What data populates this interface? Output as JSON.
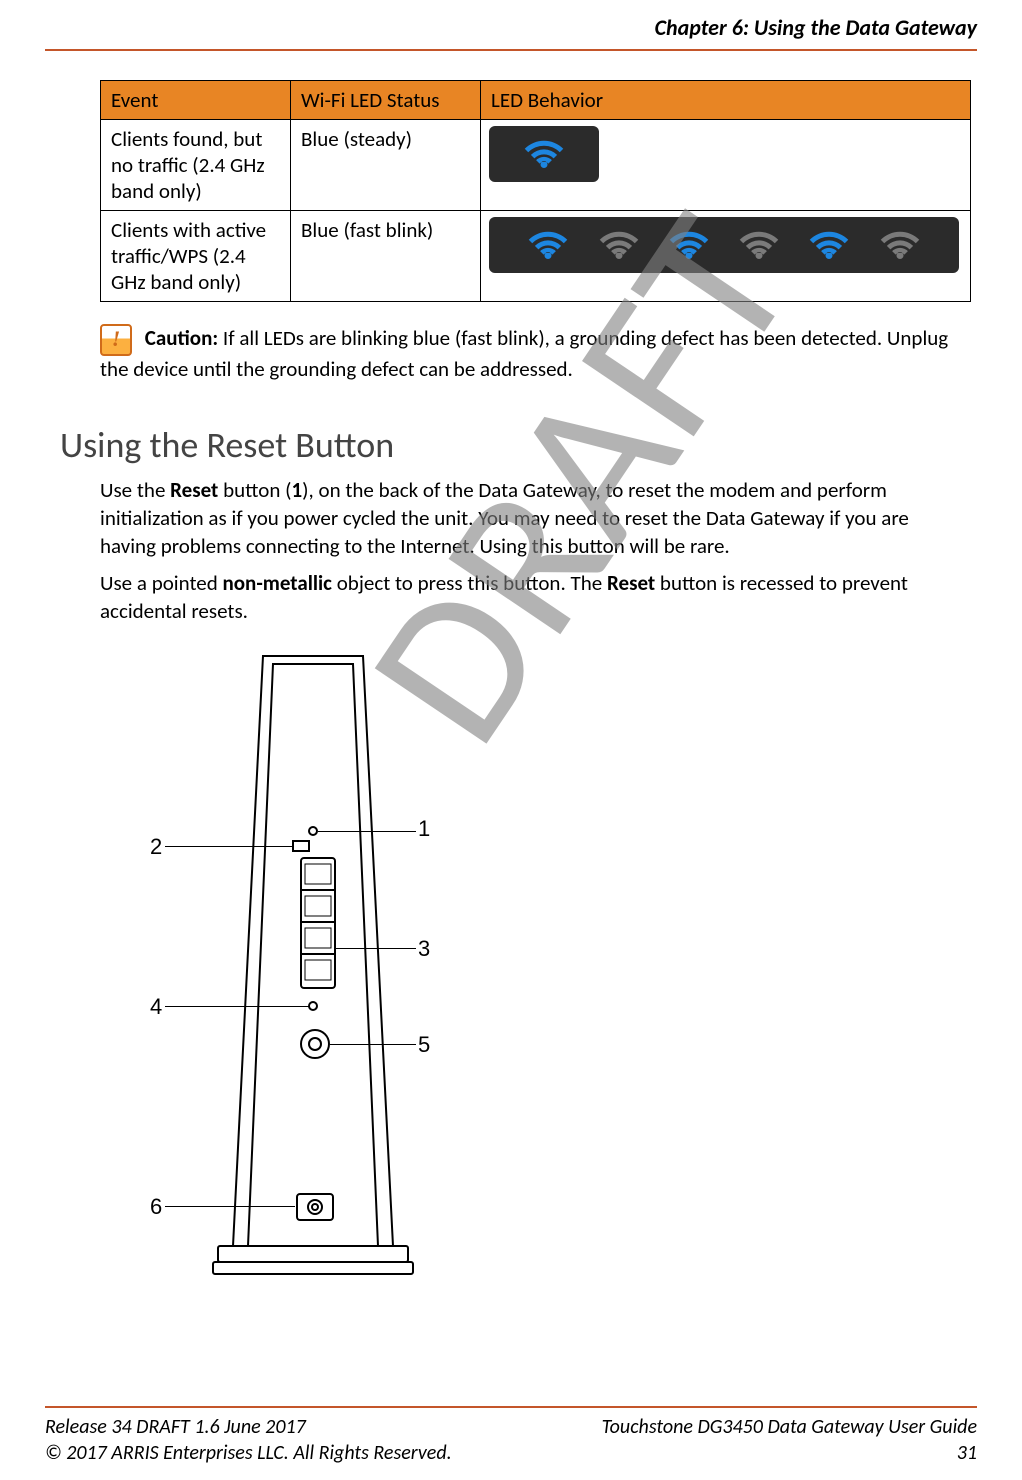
{
  "header": {
    "chapter_title": "Chapter 6: Using the Data Gateway"
  },
  "table": {
    "headers": {
      "c1": "Event",
      "c2": "Wi-Fi LED Status",
      "c3": "LED Behavior"
    },
    "rows": [
      {
        "event": "Clients found, but no traffic (2.4 GHz band only)",
        "status": "Blue (steady)"
      },
      {
        "event": "Clients with active traffic/WPS (2.4 GHz band only)",
        "status": "Blue (fast blink)"
      }
    ]
  },
  "caution": {
    "label": "Caution:",
    "text": "If all LEDs are blinking blue (fast blink), a grounding defect has been detected. Unplug the device until the grounding defect can be addressed."
  },
  "section": {
    "heading": "Using the Reset Button",
    "p1_pre": "Use the ",
    "p1_b1": "Reset",
    "p1_mid1": " button (",
    "p1_b2": "1",
    "p1_post1": "), on the back of the Data Gateway, to reset the modem and perform initialization as if you power cycled the unit. You may need to reset the Data Gateway if you are having problems connecting to the Internet. Using this button will be rare.",
    "p2_pre": "Use a pointed ",
    "p2_b1": "non-metallic",
    "p2_mid": " object to press this button. The ",
    "p2_b2": "Reset",
    "p2_post": " button is recessed to prevent accidental resets."
  },
  "callouts": {
    "n1": "1",
    "n2": "2",
    "n3": "3",
    "n4": "4",
    "n5": "5",
    "n6": "6"
  },
  "watermark": "DRAFT",
  "footer": {
    "left1": "Release 34 DRAFT 1.6    June 2017",
    "left2": "© 2017 ARRIS Enterprises LLC. All Rights Reserved.",
    "right1": "Touchstone DG3450 Data Gateway User Guide",
    "right2": "31"
  },
  "icons": {
    "wifi": "wifi-icon",
    "caution": "caution-icon"
  }
}
